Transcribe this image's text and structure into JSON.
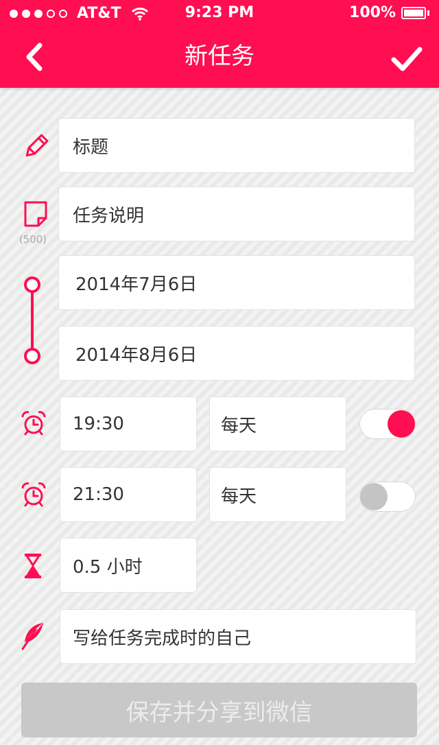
{
  "status_bar": {
    "carrier": "AT&T",
    "time": "9:23 PM",
    "battery": "100%"
  },
  "nav": {
    "title": "新任务"
  },
  "form": {
    "title_placeholder": "标题",
    "description_placeholder": "任务说明",
    "description_limit": "(500)",
    "start_date": "2014年7月6日",
    "end_date": "2014年8月6日",
    "reminders": [
      {
        "time": "19:30",
        "repeat": "每天",
        "enabled": true
      },
      {
        "time": "21:30",
        "repeat": "每天",
        "enabled": false
      }
    ],
    "duration": "0.5 小时",
    "note_placeholder": "写给任务完成时的自己"
  },
  "actions": {
    "save_share_label": "保存并分享到微信"
  },
  "colors": {
    "accent": "#ff0e52",
    "disabled_button": "#c8c8c8"
  },
  "icons": [
    "pencil-icon",
    "note-icon",
    "timeline-icon",
    "alarm-clock-icon",
    "hourglass-icon",
    "feather-icon",
    "back-chevron-icon",
    "checkmark-icon"
  ]
}
